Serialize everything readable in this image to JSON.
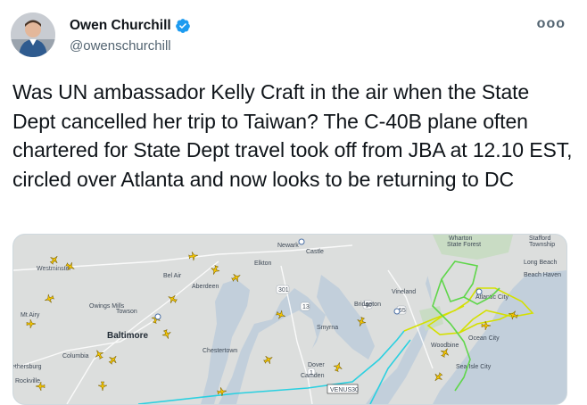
{
  "author": {
    "display_name": "Owen Churchill",
    "handle": "@owenschurchill",
    "verified": true
  },
  "more_label": "ooo",
  "tweet_text": "Was UN ambassador Kelly Craft in the air when the State Dept cancelled her trip to Taiwan? The C-40B plane often chartered for State Dept travel took off from JBA at 12.10 EST, circled over Atlanta and now looks to be returning to DC",
  "map": {
    "labels": {
      "wharton": "Wharton",
      "state_forest": "State Forest",
      "stafford": "Stafford",
      "township": "Township",
      "long_beach": "Long Beach",
      "beach_haven": "Beach Haven",
      "newark": "Newark",
      "castle": "Castle",
      "elkton": "Elkton",
      "westminster": "Westminster",
      "bel_air": "Bel Air",
      "aberdeen": "Aberdeen",
      "vineland": "Vineland",
      "bridgeton": "Bridgeton",
      "owings_mills": "Owings Mills",
      "towson": "Towson",
      "mt_airy": "Mt Airy",
      "baltimore": "Baltimore",
      "columbia": "Columbia",
      "smyrna": "Smyrna",
      "chestertown": "Chestertown",
      "dover": "Dover",
      "camden": "Camden",
      "woodbine": "Woodbine",
      "ocean_city": "Ocean City",
      "sea_isle_city": "Sea Isle City",
      "atlantic_city": "Atlantic City",
      "ethersburg": "ethersburg",
      "rockville": "Rockville",
      "flight_tag": "VENUS30",
      "road_40": "40",
      "road_55": "55",
      "road_301": "301",
      "road_13": "13",
      "road_1": "1"
    },
    "colors": {
      "land": "#e6e6e3",
      "water": "#c2cfdb",
      "track_yellow": "#d4e000",
      "track_green": "#5fd64a",
      "track_cyan": "#2ad0e0",
      "aircraft": "#f2c400"
    }
  }
}
